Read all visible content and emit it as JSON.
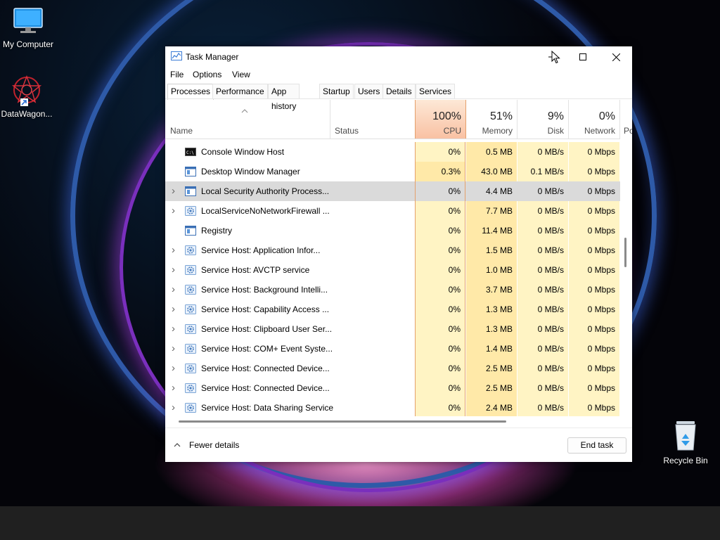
{
  "desktop": {
    "icons": [
      {
        "label": "My Computer"
      },
      {
        "label": "DataWagon..."
      },
      {
        "label": "Recycle Bin"
      }
    ]
  },
  "window": {
    "title": "Task Manager",
    "menu": [
      "File",
      "Options",
      "View"
    ],
    "tabs": [
      "Processes",
      "Performance",
      "App history",
      "Startup",
      "Users",
      "Details",
      "Services"
    ],
    "active_tab": "Processes",
    "columns": {
      "name": "Name",
      "status": "Status",
      "cpu": {
        "pct": "100%",
        "label": "CPU"
      },
      "memory": {
        "pct": "51%",
        "label": "Memory"
      },
      "disk": {
        "pct": "9%",
        "label": "Disk"
      },
      "network": {
        "pct": "0%",
        "label": "Network"
      },
      "power_truncated": "Po"
    },
    "rows": [
      {
        "name": "Console Window Host",
        "expandable": false,
        "icon": "console-icon",
        "cpu": "0%",
        "memory": "0.5 MB",
        "disk": "0 MB/s",
        "network": "0 Mbps"
      },
      {
        "name": "Desktop Window Manager",
        "expandable": false,
        "icon": "window-app-icon",
        "cpu": "0.3%",
        "memory": "43.0 MB",
        "disk": "0.1 MB/s",
        "network": "0 Mbps"
      },
      {
        "name": "Local Security Authority Process...",
        "expandable": true,
        "icon": "window-app-icon",
        "cpu": "0%",
        "memory": "4.4 MB",
        "disk": "0 MB/s",
        "network": "0 Mbps",
        "selected": true
      },
      {
        "name": "LocalServiceNoNetworkFirewall ...",
        "expandable": true,
        "icon": "gear-icon",
        "cpu": "0%",
        "memory": "7.7 MB",
        "disk": "0 MB/s",
        "network": "0 Mbps"
      },
      {
        "name": "Registry",
        "expandable": false,
        "icon": "window-app-icon",
        "cpu": "0%",
        "memory": "11.4 MB",
        "disk": "0 MB/s",
        "network": "0 Mbps"
      },
      {
        "name": "Service Host: Application Infor...",
        "expandable": true,
        "icon": "gear-icon",
        "cpu": "0%",
        "memory": "1.5 MB",
        "disk": "0 MB/s",
        "network": "0 Mbps"
      },
      {
        "name": "Service Host: AVCTP service",
        "expandable": true,
        "icon": "gear-icon",
        "cpu": "0%",
        "memory": "1.0 MB",
        "disk": "0 MB/s",
        "network": "0 Mbps"
      },
      {
        "name": "Service Host: Background Intelli...",
        "expandable": true,
        "icon": "gear-icon",
        "cpu": "0%",
        "memory": "3.7 MB",
        "disk": "0 MB/s",
        "network": "0 Mbps"
      },
      {
        "name": "Service Host: Capability Access ...",
        "expandable": true,
        "icon": "gear-icon",
        "cpu": "0%",
        "memory": "1.3 MB",
        "disk": "0 MB/s",
        "network": "0 Mbps"
      },
      {
        "name": "Service Host: Clipboard User Ser...",
        "expandable": true,
        "icon": "gear-icon",
        "cpu": "0%",
        "memory": "1.3 MB",
        "disk": "0 MB/s",
        "network": "0 Mbps"
      },
      {
        "name": "Service Host: COM+ Event Syste...",
        "expandable": true,
        "icon": "gear-icon",
        "cpu": "0%",
        "memory": "1.4 MB",
        "disk": "0 MB/s",
        "network": "0 Mbps"
      },
      {
        "name": "Service Host: Connected Device...",
        "expandable": true,
        "icon": "gear-icon",
        "cpu": "0%",
        "memory": "2.5 MB",
        "disk": "0 MB/s",
        "network": "0 Mbps"
      },
      {
        "name": "Service Host: Connected Device...",
        "expandable": true,
        "icon": "gear-icon",
        "cpu": "0%",
        "memory": "2.5 MB",
        "disk": "0 MB/s",
        "network": "0 Mbps"
      },
      {
        "name": "Service Host: Data Sharing Service",
        "expandable": true,
        "icon": "gear-icon",
        "cpu": "0%",
        "memory": "2.4 MB",
        "disk": "0 MB/s",
        "network": "0 Mbps"
      }
    ],
    "footer": {
      "fewer_details": "Fewer details",
      "end_task": "End task"
    }
  },
  "colors": {
    "cpu_header": "#f9c1a3",
    "heat_light": "#fff4c4",
    "heat_medium": "#ffe9a8",
    "selected_row": "#dadada"
  }
}
